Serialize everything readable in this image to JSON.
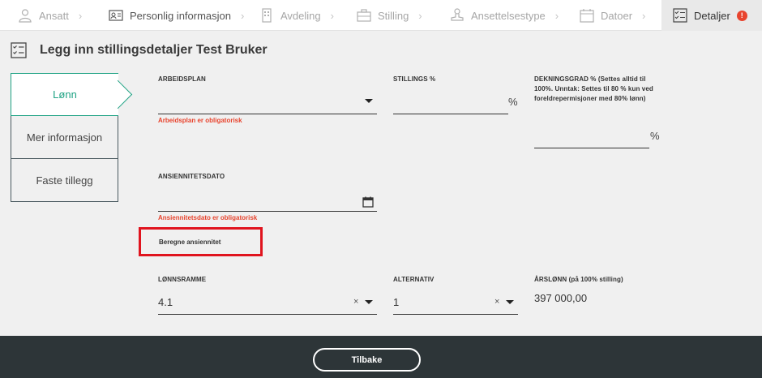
{
  "steps": [
    {
      "label": "Ansatt",
      "icon": "person-icon"
    },
    {
      "label": "Personlig informasjon",
      "icon": "id-card-icon"
    },
    {
      "label": "Avdeling",
      "icon": "building-icon"
    },
    {
      "label": "Stilling",
      "icon": "briefcase-icon"
    },
    {
      "label": "Ansettelsestype",
      "icon": "stamp-icon"
    },
    {
      "label": "Datoer",
      "icon": "calendar-icon"
    },
    {
      "label": "Detaljer",
      "icon": "checklist-icon",
      "alert": "!"
    }
  ],
  "page": {
    "title": "Legg inn stillingsdetaljer Test Bruker"
  },
  "tabs": [
    {
      "label": "Lønn"
    },
    {
      "label": "Mer informasjon"
    },
    {
      "label": "Faste tillegg"
    }
  ],
  "form": {
    "arbeidsplan": {
      "label": "ARBEIDSPLAN",
      "value": "",
      "error": "Arbeidsplan er obligatorisk"
    },
    "stillings_pct": {
      "label": "STILLINGS %",
      "value": "",
      "unit": "%"
    },
    "dekningsgrad": {
      "label": "DEKNINGSGRAD % (Settes alltid til 100%. Unntak: Settes til 80 % kun ved foreldrepermisjoner med 80% lønn)",
      "value": "",
      "unit": "%"
    },
    "ansiennitetsdato": {
      "label": "ANSIENNITETSDATO",
      "value": "",
      "error": "Ansiennitetsdato er obligatorisk"
    },
    "beregne_label": "Beregne ansiennitet",
    "lonnsramme": {
      "label": "LØNNSRAMME",
      "value": "4.1",
      "clear": "×"
    },
    "alternativ": {
      "label": "ALTERNATIV",
      "value": "1",
      "clear": "×"
    },
    "arslonn": {
      "label": "ÅRSLØNN (på 100% stilling)",
      "value": "397 000,00"
    }
  },
  "footer": {
    "back_label": "Tilbake"
  },
  "colors": {
    "accent": "#1fa384",
    "error": "#e8442e",
    "footer_bg": "#2d3538",
    "highlight": "#e0141e"
  }
}
